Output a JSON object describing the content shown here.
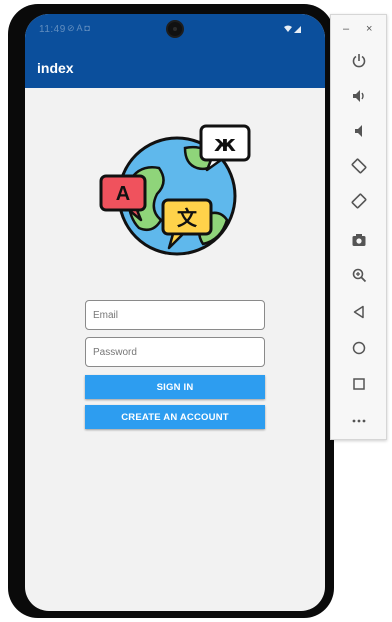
{
  "status_bar": {
    "time": "11:49",
    "left_icons": "⊘ A ◘"
  },
  "app_bar": {
    "title": "index"
  },
  "login": {
    "email_placeholder": "Email",
    "password_placeholder": "Password",
    "sign_in_label": "SIGN IN",
    "create_account_label": "CREATE AN ACCOUNT"
  },
  "logo": {
    "letter_a": "A",
    "letter_zh": "文",
    "letter_jp": "ж"
  },
  "emulator_toolbar": {
    "minimize": "–",
    "close": "×",
    "icons": [
      "power-icon",
      "volume-up-icon",
      "volume-down-icon",
      "rotate-left-icon",
      "rotate-right-icon",
      "camera-icon",
      "zoom-icon",
      "back-icon",
      "home-icon",
      "overview-icon",
      "more-icon"
    ]
  },
  "colors": {
    "app_bar": "#0b4f9c",
    "button": "#2d9df0",
    "screen_bg": "#f2f2f2"
  }
}
